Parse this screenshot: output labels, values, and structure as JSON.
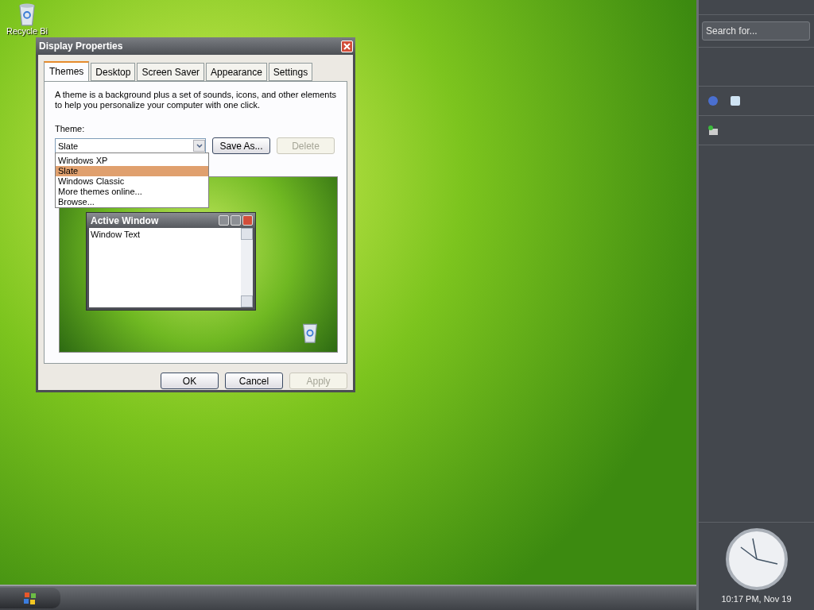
{
  "desktop": {
    "icons": [
      {
        "label": "Recycle Bi"
      }
    ]
  },
  "dialog": {
    "title": "Display Properties",
    "tabs": [
      {
        "label": "Themes",
        "selected": true
      },
      {
        "label": "Desktop",
        "selected": false
      },
      {
        "label": "Screen Saver",
        "selected": false
      },
      {
        "label": "Appearance",
        "selected": false
      },
      {
        "label": "Settings",
        "selected": false
      }
    ],
    "description": "A theme is a background plus a set of sounds, icons, and other elements to help you personalize your computer with one click.",
    "theme_label": "Theme:",
    "theme_select": {
      "value": "Slate",
      "expanded": true,
      "options": [
        {
          "label": "Windows XP",
          "selected": false
        },
        {
          "label": "Slate",
          "selected": true
        },
        {
          "label": "Windows Classic",
          "selected": false
        },
        {
          "label": "More themes online...",
          "selected": false
        },
        {
          "label": "Browse...",
          "selected": false
        }
      ]
    },
    "side_buttons": [
      {
        "label": "Save As...",
        "disabled": false
      },
      {
        "label": "Delete",
        "disabled": true
      }
    ],
    "preview": {
      "window_title": "Active Window",
      "window_text": "Window Text"
    },
    "buttons": [
      {
        "label": "OK",
        "disabled": false
      },
      {
        "label": "Cancel",
        "disabled": false
      },
      {
        "label": "Apply",
        "disabled": true
      }
    ]
  },
  "sidebar": {
    "search": {
      "placeholder": "Search for..."
    },
    "clock": "10:17 PM, Nov 19"
  }
}
